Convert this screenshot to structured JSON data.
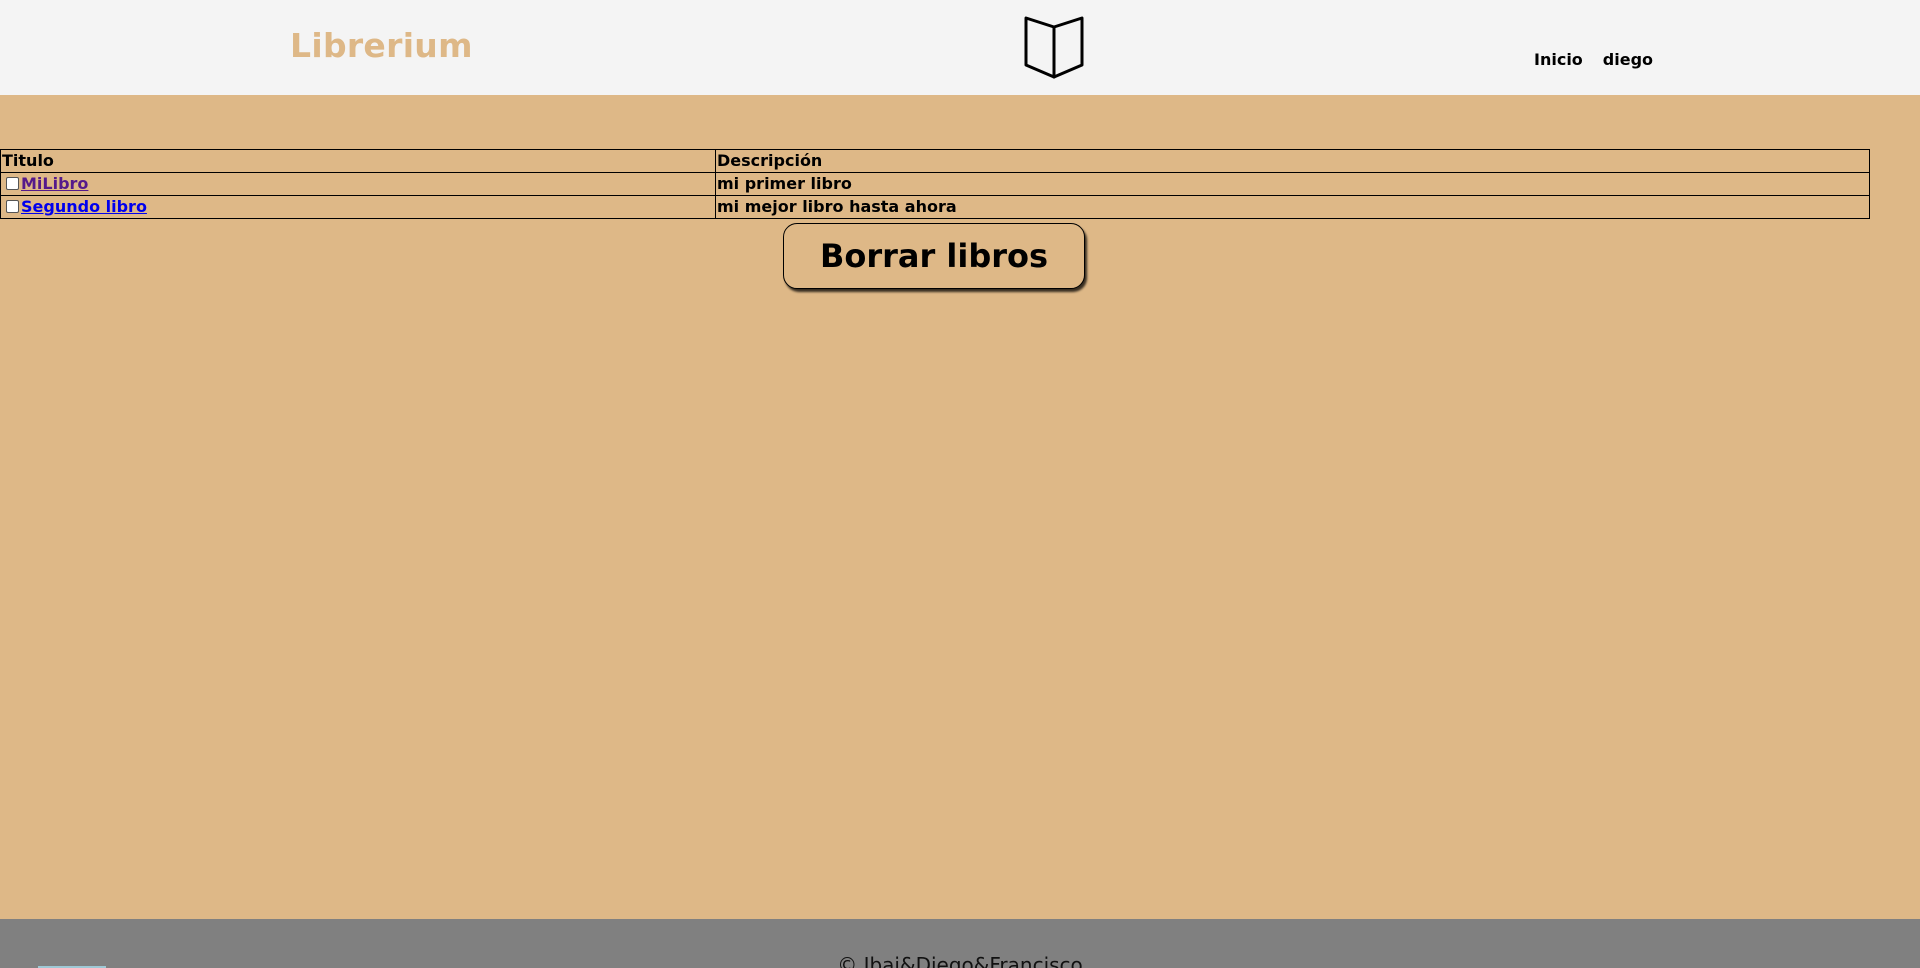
{
  "header": {
    "brand": "Librerium",
    "logo_icon": "open-book-icon",
    "nav": [
      {
        "label": "Inicio"
      },
      {
        "label": "diego"
      }
    ]
  },
  "table": {
    "columns": [
      "Titulo",
      "Descripción"
    ],
    "rows": [
      {
        "title": "MiLibro",
        "description": "mi primer libro",
        "checked": false,
        "visited": true
      },
      {
        "title": "Segundo libro",
        "description": "mi mejor libro hasta ahora",
        "checked": false,
        "visited": false
      }
    ]
  },
  "actions": {
    "delete_label": "Borrar libros"
  },
  "footer": {
    "text": "© Ibai&Diego&Francisco"
  },
  "colors": {
    "page_bg": "#deb887",
    "header_bg": "#f4f4f4",
    "footer_bg": "#808080",
    "brand": "#deb887"
  }
}
